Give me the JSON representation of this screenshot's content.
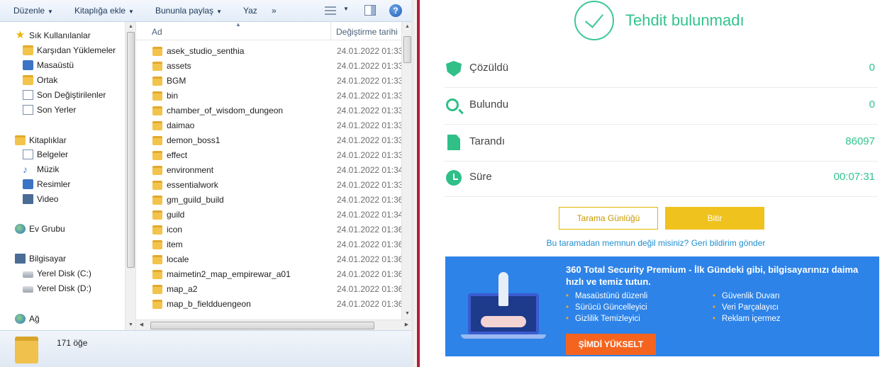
{
  "explorer": {
    "toolbar": {
      "organize": "Düzenle",
      "add_to_library": "Kitaplığa ekle",
      "share_with": "Bununla paylaş",
      "burn": "Yaz",
      "more": "»",
      "help": "?"
    },
    "nav": {
      "favorites": {
        "header": "Sık Kullanılanlar",
        "items": [
          "Karşıdan Yüklemeler",
          "Masaüstü",
          "Ortak",
          "Son Değiştirilenler",
          "Son Yerler"
        ]
      },
      "libraries": {
        "header": "Kitaplıklar",
        "items": [
          "Belgeler",
          "Müzik",
          "Resimler",
          "Video"
        ]
      },
      "homegroup": "Ev Grubu",
      "computer": {
        "header": "Bilgisayar",
        "items": [
          "Yerel Disk (C:)",
          "Yerel Disk (D:)"
        ]
      },
      "network": "Ağ"
    },
    "columns": {
      "name": "Ad",
      "date": "Değiştirme tarihi"
    },
    "files": [
      {
        "name": "asek_studio_senthia",
        "date": "24.01.2022 01:33"
      },
      {
        "name": "assets",
        "date": "24.01.2022 01:33"
      },
      {
        "name": "BGM",
        "date": "24.01.2022 01:33"
      },
      {
        "name": "bin",
        "date": "24.01.2022 01:33"
      },
      {
        "name": "chamber_of_wisdom_dungeon",
        "date": "24.01.2022 01:33"
      },
      {
        "name": "daimao",
        "date": "24.01.2022 01:33"
      },
      {
        "name": "demon_boss1",
        "date": "24.01.2022 01:33"
      },
      {
        "name": "effect",
        "date": "24.01.2022 01:33"
      },
      {
        "name": "environment",
        "date": "24.01.2022 01:34"
      },
      {
        "name": "essentialwork",
        "date": "24.01.2022 01:33"
      },
      {
        "name": "gm_guild_build",
        "date": "24.01.2022 01:36"
      },
      {
        "name": "guild",
        "date": "24.01.2022 01:34"
      },
      {
        "name": "icon",
        "date": "24.01.2022 01:36"
      },
      {
        "name": "item",
        "date": "24.01.2022 01:36"
      },
      {
        "name": "locale",
        "date": "24.01.2022 01:36"
      },
      {
        "name": "maimetin2_map_empirewar_a01",
        "date": "24.01.2022 01:36"
      },
      {
        "name": "map_a2",
        "date": "24.01.2022 01:36"
      },
      {
        "name": "map_b_fieldduengeon",
        "date": "24.01.2022 01:36"
      }
    ],
    "status": {
      "item_count": "171 öğe"
    }
  },
  "security": {
    "title": "Tehdit bulunmadı",
    "stats": [
      {
        "label": "Çözüldü",
        "value": "0",
        "icon": "shield-check-icon"
      },
      {
        "label": "Bulundu",
        "value": "0",
        "icon": "magnifier-icon"
      },
      {
        "label": "Tarandı",
        "value": "86097",
        "icon": "document-icon"
      },
      {
        "label": "Süre",
        "value": "00:07:31",
        "icon": "clock-icon"
      }
    ],
    "buttons": {
      "scan_log": "Tarama Günlüğü",
      "finish": "Bitir"
    },
    "feedback_link": "Bu taramadan memnun değil misiniz? Geri bildirim gönder",
    "promo": {
      "title": "360 Total Security Premium - İlk Gündeki gibi, bilgisayarınızı daima hızlı ve temiz tutun.",
      "features_left": [
        "Masaüstünü düzenli",
        "Sürücü Güncelleyici",
        "Gizlilik Temizleyici"
      ],
      "features_right": [
        "Güvenlik Duvarı",
        "Veri Parçalayıcı",
        "Reklam içermez"
      ],
      "upgrade_button": "ŞİMDİ YÜKSELT"
    },
    "colors": {
      "accent": "#31c48d",
      "link": "#1f8ecf",
      "promo_bg": "#2d83e8",
      "upgrade": "#f5641e",
      "finish": "#f0c21d"
    }
  }
}
